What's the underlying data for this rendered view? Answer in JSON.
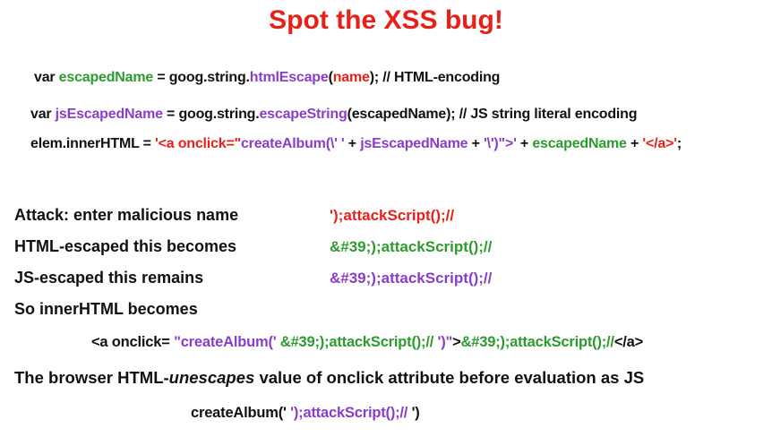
{
  "title": "Spot the XSS bug!",
  "colors": {
    "red": "#e8201a",
    "green": "#2e9a2e",
    "purple": "#8a3ec8",
    "black": "#111111"
  },
  "code": {
    "line1": {
      "p1": "var ",
      "p2": "escapedName",
      "p3": " = goog.string.",
      "p4": "htmlEscape",
      "p5": "(",
      "p6": "name",
      "p7": ");  // HTML-encoding"
    },
    "line2": {
      "p1": "var ",
      "p2": "jsEscapedName",
      "p3": " = goog.string.",
      "p4": "escapeString",
      "p5": "(escapedName); // JS string literal encoding"
    },
    "line3": {
      "p1": "elem.innerHTML = ",
      "p2": "'<a onclick=\"",
      "p3": "createAlbum(\\' '",
      "p4": " + ",
      "p5": "jsEscapedName",
      "p6": " + ",
      "p7": "'\\')\">'",
      "p8": " + ",
      "p9": "escapedName",
      "p10": " + ",
      "p11": "'</a>'",
      "p12": ";"
    }
  },
  "explain": {
    "attack_label": "Attack: enter malicious name",
    "attack_value": "');attackScript();//",
    "html_label": "HTML-escaped this becomes",
    "html_value": "&#39;);attackScript();//",
    "js_label": "JS-escaped this remains",
    "js_value": "&#39;);attackScript();//",
    "so_label": "So innerHTML becomes",
    "result_line": {
      "p1": "<a onclick= ",
      "p2": "\"createAlbum(' ",
      "p3": "&#39;);attackScript();// ",
      "p4": "')\"",
      "p5": ">",
      "p6": "&#39;);attackScript();//",
      "p7": "</a>"
    },
    "browser_line": {
      "p1": "The browser HTML-",
      "p2": "unescapes",
      "p3": " value of ",
      "p4": "onclick",
      "p5": " attribute before evaluation as JS"
    },
    "final_line": {
      "p1": "createAlbum(' ",
      "p2": "');attackScript();// ",
      "p3": "')"
    }
  }
}
